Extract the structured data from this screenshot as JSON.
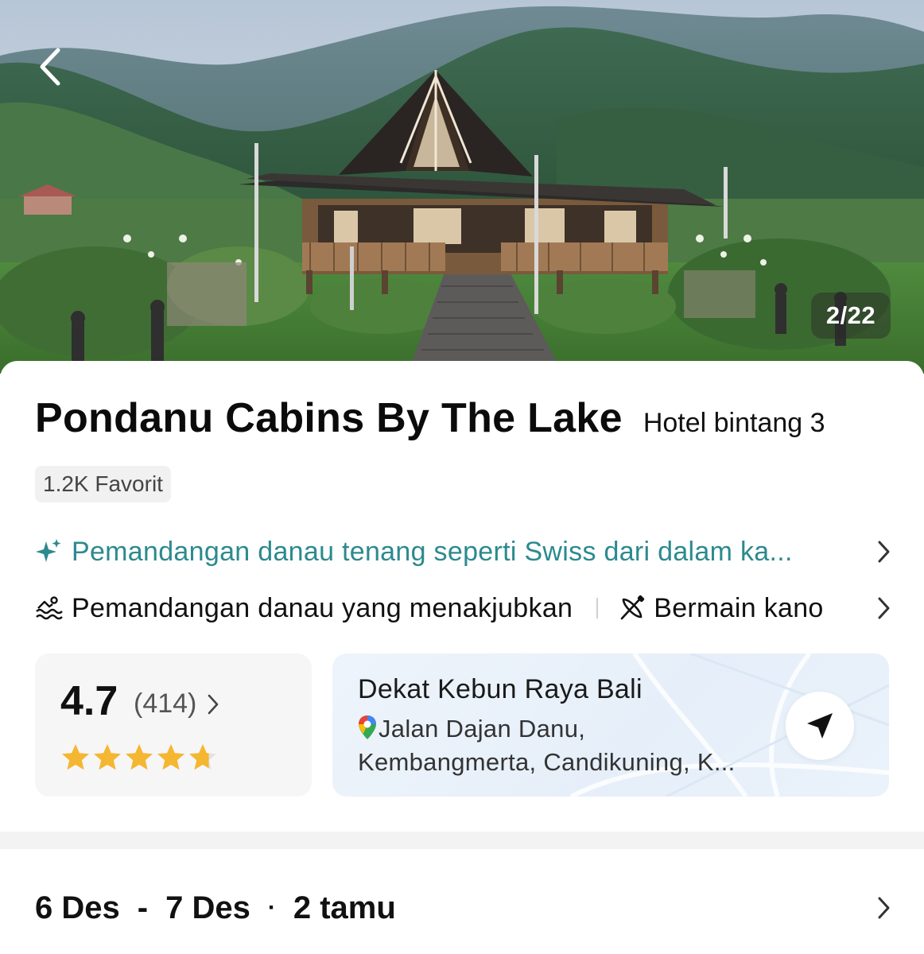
{
  "hero": {
    "photo_counter": "2/22"
  },
  "hotel": {
    "name": "Pondanu Cabins By The Lake",
    "class_label": "Hotel bintang 3",
    "favorites": "1.2K Favorit"
  },
  "highlight": {
    "text": "Pemandangan danau tenang seperti Swiss dari dalam ka...",
    "color": "#2c8a8e"
  },
  "features": [
    {
      "icon": "lake-waves-icon",
      "label": "Pemandangan danau yang menakjubkan"
    },
    {
      "icon": "canoe-paddle-icon",
      "label": "Bermain kano"
    }
  ],
  "rating": {
    "score": "4.7",
    "count": "(414)",
    "stars": 4.7,
    "star_color": "#f5b731"
  },
  "location": {
    "title": "Dekat Kebun Raya Bali",
    "address_line1": "Jalan Dajan Danu,",
    "address_line2": "Kembangmerta, Candikuning, K..."
  },
  "stay": {
    "check_in": "6 Des",
    "separator": "-",
    "check_out": "7 Des",
    "dot": "·",
    "guests": "2 tamu"
  }
}
